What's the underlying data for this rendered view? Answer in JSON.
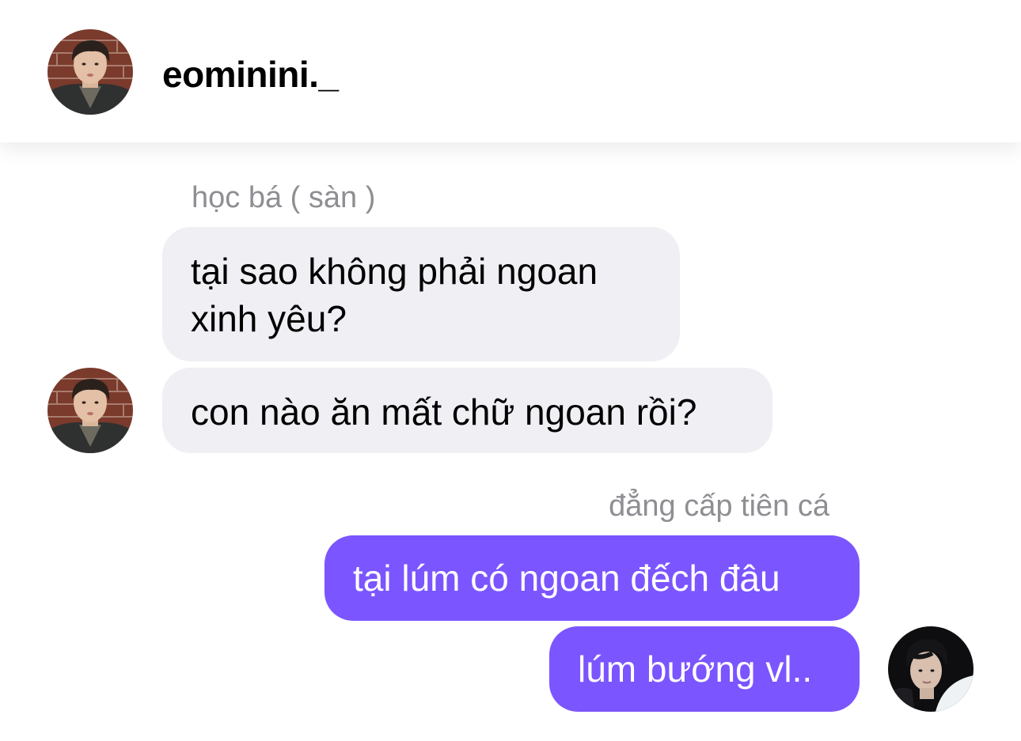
{
  "header": {
    "username": "eominini._",
    "avatar_icon": "profile-photo-avatar"
  },
  "messages": [
    {
      "reply_to": "học bá ( sàn )",
      "direction": "incoming",
      "lines": [
        "tại sao không phải ngoan",
        "xinh yêu?"
      ]
    },
    {
      "direction": "incoming",
      "lines": [
        "con nào ăn mất chữ ngoan rồi?"
      ]
    },
    {
      "reply_to": "đẳng cấp tiên cá",
      "direction": "outgoing",
      "lines": [
        "tại lúm có ngoan đếch đâu"
      ]
    },
    {
      "direction": "outgoing",
      "lines": [
        "lúm bướng vl.."
      ]
    }
  ],
  "colors": {
    "incoming_bubble": "#efeff4",
    "outgoing_bubble": "#7b55ff",
    "reply_label": "#8e8e93"
  }
}
